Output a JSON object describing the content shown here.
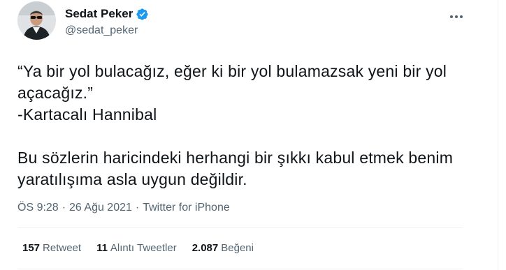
{
  "author": {
    "display_name": "Sedat Peker",
    "handle": "@sedat_peker",
    "verified": true
  },
  "icons": {
    "verified": "verified-badge-icon",
    "more": "more-dots-icon",
    "avatar": "profile-avatar"
  },
  "tweet": {
    "line1": "“Ya bir yol bulacağız, eğer ki bir yol bulamazsak yeni bir yol açacağız.”",
    "line2": "-Kartacalı Hannibal",
    "line3": "Bu sözlerin haricindeki herhangi bir şıkkı kabul etmek benim yaratılışıma asla uygun değildir."
  },
  "meta": {
    "time": "ÖS 9:28",
    "sep1": "·",
    "date": "26 Ağu 2021",
    "sep2": "·",
    "source": "Twitter for iPhone"
  },
  "stats": {
    "retweets_count": "157",
    "retweets_label": "Retweet",
    "quotes_count": "11",
    "quotes_label": "Alıntı Tweetler",
    "likes_count": "2.087",
    "likes_label": "Beğeni"
  },
  "colors": {
    "text": "#0f1419",
    "secondary": "#536471",
    "verified": "#1d9bf0",
    "divider": "#eff3f4"
  }
}
